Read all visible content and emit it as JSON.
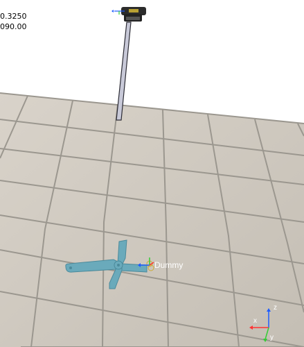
{
  "viewport": {
    "readout_line_1": "0.3250",
    "readout_line_2": "090.00",
    "background_color": "#ffffff",
    "floor_tile_color_light": "#d3ccc2",
    "floor_grout_color": "#9b978f"
  },
  "scene_objects": {
    "dummy_label": "Dummy",
    "dummy_color": "#6aaabb"
  },
  "axis_gizmo": {
    "x_label": "x",
    "y_label": "y",
    "z_label": "z"
  }
}
